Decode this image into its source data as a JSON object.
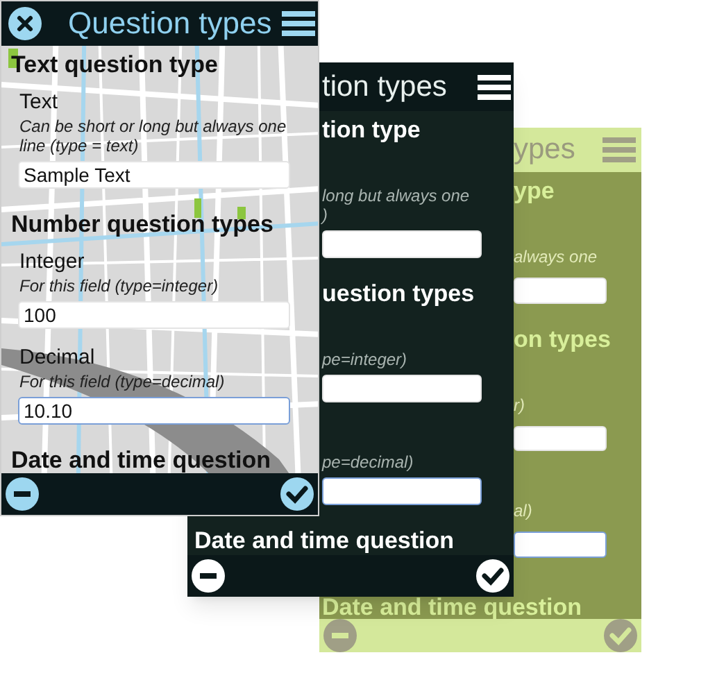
{
  "screens": [
    {
      "kind": "map",
      "close_button": true,
      "title": "Question types",
      "items": [
        {
          "kind": "heading",
          "text": "Text question type"
        },
        {
          "kind": "label",
          "text": "Text"
        },
        {
          "kind": "hint",
          "text": "Can be short or long but always one line (type = text)"
        },
        {
          "kind": "field",
          "value": "Sample Text",
          "focused": false
        },
        {
          "kind": "heading",
          "text": "Number question types"
        },
        {
          "kind": "label",
          "text": "Integer"
        },
        {
          "kind": "hint",
          "text": "For this field (type=integer)"
        },
        {
          "kind": "field",
          "value": "100",
          "focused": false
        },
        {
          "kind": "label",
          "text": "Decimal"
        },
        {
          "kind": "hint",
          "text": "For this field (type=decimal)"
        },
        {
          "kind": "field",
          "value": "10.10",
          "focused": true
        },
        {
          "kind": "heading",
          "text": "Date and time question"
        }
      ]
    },
    {
      "kind": "dark",
      "title": "tion types",
      "items": [
        {
          "kind": "heading",
          "text": "tion type"
        },
        {
          "kind": "hint",
          "text": "long but always one"
        },
        {
          "kind": "hint",
          "text": ")"
        },
        {
          "kind": "field",
          "focused": false
        },
        {
          "kind": "heading",
          "text": "uestion types"
        },
        {
          "kind": "hint",
          "text": "pe=integer)"
        },
        {
          "kind": "field",
          "focused": false
        },
        {
          "kind": "hint",
          "text": "pe=decimal)"
        },
        {
          "kind": "field",
          "focused": true
        },
        {
          "kind": "heading",
          "text": "Date and time question"
        }
      ]
    },
    {
      "kind": "green",
      "title": "ypes",
      "items": [
        {
          "kind": "heading",
          "text": "ype"
        },
        {
          "kind": "hint",
          "text": "always one"
        },
        {
          "kind": "field",
          "focused": false
        },
        {
          "kind": "heading",
          "text": "on types"
        },
        {
          "kind": "hint",
          "text": "r)"
        },
        {
          "kind": "field",
          "focused": false
        },
        {
          "kind": "hint",
          "text": "al)"
        },
        {
          "kind": "field",
          "focused": true
        },
        {
          "kind": "heading",
          "text": "Date and time question"
        }
      ]
    }
  ]
}
